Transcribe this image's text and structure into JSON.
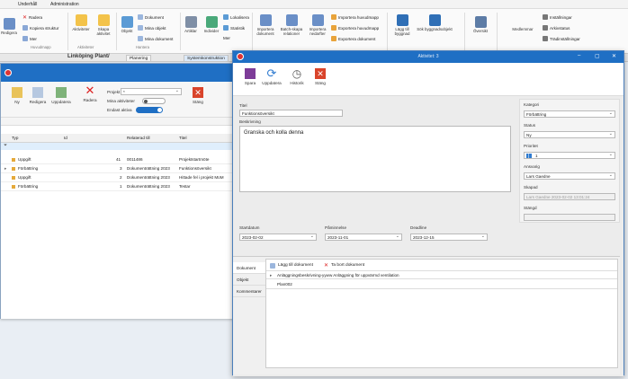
{
  "main": {
    "menu": [
      "Underhåll",
      "Administration"
    ],
    "ribbon": {
      "redigera": "Redigera",
      "radera": "Radera",
      "kopiera": "Kopiera struktur",
      "mer": "Mer",
      "aktiviteter": "Aktiviteter",
      "skapa_aktivitet": "Skapa aktivitet",
      "objekt": "Objekt",
      "dokument": "Dokument",
      "mina_objekt": "Mina objekt",
      "mina_dokument": "Mina dokument",
      "artiklar": "Artiklar",
      "individer": "Individer",
      "lokalisera": "Lokalisera",
      "statistik": "Statistik",
      "mer2": "Mer",
      "importera_dokument": "Importera dokument",
      "batch_skapa": "Batch-skapa relationer",
      "importera_nedarfter": "Importera nedarfter",
      "importera_huvudmapp": "Importera huvudmapp",
      "exportera_huvudmapp": "Exportera huvudmapp",
      "exportera_dokument": "Exportera dokument",
      "lagg_till_byggnad": "Lägg till byggnad",
      "sok_bygg": "Sök byggnadsobjekt",
      "oversikt": "Översikt",
      "medlemmar": "Medlemmar",
      "installningar": "Inställningar",
      "arkivstatus": "Arkivstatus",
      "tradinstallningar": "Trädinställningar",
      "group_huvudmapp": "Huvudmapp",
      "group_aktiviteter": "Aktiviteter",
      "group_hantera": "Hantera"
    },
    "tabs": {
      "breadcrumb": "Linköping Plant/",
      "tab1": "Planering",
      "tab2": "Systemkonstruktion"
    }
  },
  "left_window": {
    "toolbar": {
      "ny": "Ny",
      "redigera": "Redigera",
      "uppdatera": "Uppdatera",
      "radera": "Radera",
      "projekt_label": "Projekt",
      "projekt_value": "*",
      "mina_aktiviteter": "Mina aktiviteter",
      "endast_aktiva": "Endast aktiva",
      "stang": "Stäng"
    },
    "grid": {
      "headers": [
        "Typ",
        "Id",
        "Relaterad till",
        "Titel"
      ],
      "rows": [
        {
          "typ": "Uppgift",
          "id": "41",
          "rel": "0011486",
          "titel": "Projektstartmöte"
        },
        {
          "typ": "Förbättring",
          "id": "3",
          "rel": "Dokumenträttning 2023",
          "titel": "Funktionsöversikt"
        },
        {
          "typ": "Uppgift",
          "id": "2",
          "rel": "Dokumenträttning 2023",
          "titel": "Hittade fel i projekt MoM"
        },
        {
          "typ": "Förbättring",
          "id": "1",
          "rel": "Dokumenträttning 2023",
          "titel": "Testar"
        }
      ]
    }
  },
  "dialog": {
    "title": "Aktivitet: 3",
    "toolbar": {
      "spara": "Spara",
      "uppdatera": "Uppdatera",
      "historik": "Historik",
      "stang": "Stäng"
    },
    "form": {
      "titel_label": "Titel",
      "titel_value": "Funktionsöversikt",
      "beskrivning_label": "Beskrivning",
      "beskrivning_value": "Granska och kolla denna",
      "startdatum_label": "Startdatum",
      "startdatum_value": "2023-02-02",
      "paminnelse_label": "Påminnelse",
      "paminnelse_value": "2023-11-01",
      "deadline_label": "Deadline",
      "deadline_value": "2023-12-15"
    },
    "side": {
      "kategori_label": "Kategori",
      "kategori_value": "Förbättring",
      "status_label": "Status",
      "status_value": "Ny",
      "prioritet_label": "Prioritet",
      "prioritet_value": "1",
      "ansvarig_label": "Ansvarig",
      "ansvarig_value": "Lars Gaedne",
      "skapad_label": "Skapad",
      "skapad_value": "Lars Gaedne 2023-02-02 13:01:24",
      "stangd_label": "Stängd",
      "stangd_value": ""
    },
    "bottom": {
      "tabs": [
        "Dokument",
        "Objekt",
        "Kommentarer"
      ],
      "add_doc": "Lägg till dokument",
      "remove_doc": "Ta bort dokument",
      "rows": [
        "Anläggningsbeskrivning-yyww Anläggning för uppvärmd ventilation",
        "Plan002"
      ]
    }
  }
}
